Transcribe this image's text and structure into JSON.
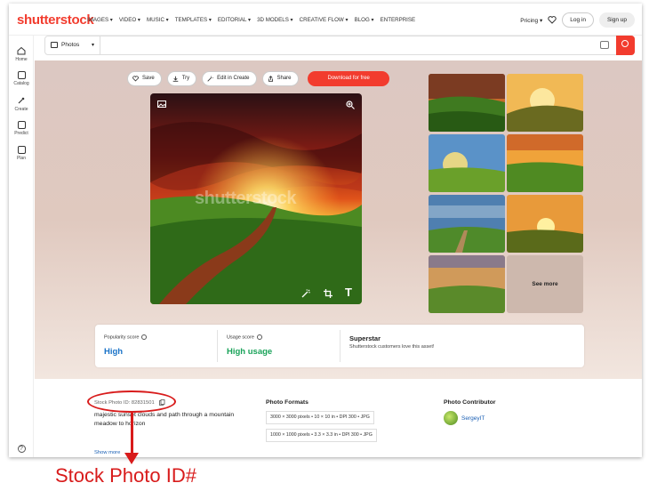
{
  "header": {
    "logo": "shutterstock",
    "nav": [
      "IMAGES ▾",
      "VIDEO ▾",
      "MUSIC ▾",
      "TEMPLATES ▾",
      "EDITORIAL ▾",
      "3D MODELS ▾",
      "CREATIVE FLOW ▾",
      "BLOG ▾",
      "ENTERPRISE"
    ],
    "pricing": "Pricing ▾",
    "login": "Log in",
    "signup": "Sign up"
  },
  "sidebar": {
    "items": [
      {
        "label": "Home",
        "icon": "home-icon"
      },
      {
        "label": "Catalog",
        "icon": "catalog-icon"
      },
      {
        "label": "Create",
        "icon": "create-icon"
      },
      {
        "label": "Predict",
        "icon": "predict-icon"
      },
      {
        "label": "Plan",
        "icon": "plan-icon"
      }
    ],
    "help": "?"
  },
  "search": {
    "type": "Photos",
    "placeholder": ""
  },
  "actions": {
    "save": "Save",
    "try": "Try",
    "edit": "Edit in Create",
    "share": "Share",
    "download": "Download for free"
  },
  "image": {
    "watermark": "shutterstock"
  },
  "related": {
    "see_more": "See more"
  },
  "scores": {
    "popularity_label": "Popularity score",
    "popularity_value": "High",
    "usage_label": "Usage score",
    "usage_value": "High usage",
    "superstar_title": "Superstar",
    "superstar_desc": "Shutterstock customers love this asset!",
    "colors": {
      "popularity": "#1a73c8",
      "usage": "#1aa35a"
    }
  },
  "details": {
    "stock_id": "Stock Photo ID: 82831501",
    "description": "majestic sunset clouds and path through a mountain meadow to horizon",
    "show_more": "Show more",
    "formats_title": "Photo Formats",
    "formats": [
      "3000 × 3000 pixels • 10 × 10 in • DPI 300 • JPG",
      "1000 × 1000 pixels • 3.3 × 3.3 in • DPI 300 • JPG"
    ],
    "contributor_title": "Photo Contributor",
    "contributor_name": "SergeyIT"
  },
  "annotation": {
    "label": "Stock Photo ID#",
    "color": "#d81b1b"
  }
}
